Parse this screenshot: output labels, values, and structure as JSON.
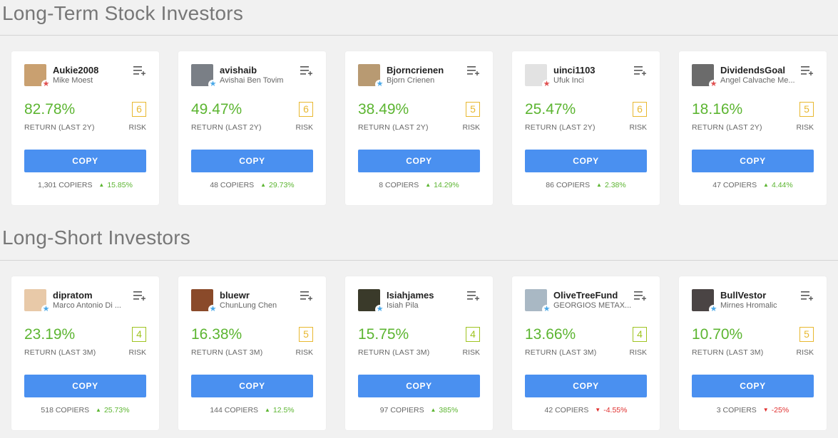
{
  "sections": [
    {
      "title": "Long-Term Stock Investors",
      "investors": [
        {
          "username": "Aukie2008",
          "fullname": "Mike Moest",
          "return": "82.78%",
          "return_label": "RETURN (LAST 2Y)",
          "risk": "6",
          "risk_label": "RISK",
          "copy_label": "COPY",
          "copiers": "1,301 COPIERS",
          "change": "15.85%",
          "direction": "up",
          "badge": "star-red",
          "avatar_color": "#c9a070"
        },
        {
          "username": "avishaib",
          "fullname": "Avishai Ben Tovim",
          "return": "49.47%",
          "return_label": "RETURN (LAST 2Y)",
          "risk": "6",
          "risk_label": "RISK",
          "copy_label": "COPY",
          "copiers": "48 COPIERS",
          "change": "29.73%",
          "direction": "up",
          "badge": "star-blue",
          "avatar_color": "#7a7f86"
        },
        {
          "username": "Bjorncrienen",
          "fullname": "Bjorn Crienen",
          "return": "38.49%",
          "return_label": "RETURN (LAST 2Y)",
          "risk": "5",
          "risk_label": "RISK",
          "copy_label": "COPY",
          "copiers": "8 COPIERS",
          "change": "14.29%",
          "direction": "up",
          "badge": "star-blue",
          "avatar_color": "#b89a72"
        },
        {
          "username": "uinci1103",
          "fullname": "Ufuk Inci",
          "return": "25.47%",
          "return_label": "RETURN (LAST 2Y)",
          "risk": "6",
          "risk_label": "RISK",
          "copy_label": "COPY",
          "copiers": "86 COPIERS",
          "change": "2.38%",
          "direction": "up",
          "badge": "star-red",
          "avatar_color": "#e2e2e2"
        },
        {
          "username": "DividendsGoal",
          "fullname": "Angel Calvache Me...",
          "return": "18.16%",
          "return_label": "RETURN (LAST 2Y)",
          "risk": "5",
          "risk_label": "RISK",
          "copy_label": "COPY",
          "copiers": "47 COPIERS",
          "change": "4.44%",
          "direction": "up",
          "badge": "star-red",
          "avatar_color": "#6b6b6b"
        }
      ]
    },
    {
      "title": "Long-Short Investors",
      "investors": [
        {
          "username": "dipratom",
          "fullname": "Marco Antonio Di ...",
          "return": "23.19%",
          "return_label": "RETURN (LAST 3M)",
          "risk": "4",
          "risk_label": "RISK",
          "copy_label": "COPY",
          "copiers": "518 COPIERS",
          "change": "25.73%",
          "direction": "up",
          "badge": "star-blue",
          "avatar_color": "#e8c9a8"
        },
        {
          "username": "bluewr",
          "fullname": "ChunLung Chen",
          "return": "16.38%",
          "return_label": "RETURN (LAST 3M)",
          "risk": "5",
          "risk_label": "RISK",
          "copy_label": "COPY",
          "copiers": "144 COPIERS",
          "change": "12.5%",
          "direction": "up",
          "badge": "star-blue",
          "avatar_color": "#8a4a2a"
        },
        {
          "username": "Isiahjames",
          "fullname": "Isiah Pila",
          "return": "15.75%",
          "return_label": "RETURN (LAST 3M)",
          "risk": "4",
          "risk_label": "RISK",
          "copy_label": "COPY",
          "copiers": "97 COPIERS",
          "change": "385%",
          "direction": "up",
          "badge": "star-blue",
          "avatar_color": "#3a3a2a"
        },
        {
          "username": "OliveTreeFund",
          "fullname": "GEORGIOS METAX...",
          "return": "13.66%",
          "return_label": "RETURN (LAST 3M)",
          "risk": "4",
          "risk_label": "RISK",
          "copy_label": "COPY",
          "copiers": "42 COPIERS",
          "change": "-4.55%",
          "direction": "down",
          "badge": "star-blue",
          "avatar_color": "#a9b8c4"
        },
        {
          "username": "BullVestor",
          "fullname": "Mirnes Hromalic",
          "return": "10.70%",
          "return_label": "RETURN (LAST 3M)",
          "risk": "5",
          "risk_label": "RISK",
          "copy_label": "COPY",
          "copiers": "3 COPIERS",
          "change": "-25%",
          "direction": "down",
          "badge": "star-blue",
          "avatar_color": "#4a4444"
        }
      ]
    }
  ],
  "colors": {
    "positive": "#5cb531",
    "negative": "#e0302f",
    "copy_button": "#4a90f0",
    "risk_4": "#9fc420",
    "risk_5": "#e8b830",
    "risk_6": "#e8b830",
    "badge_red": "#e05050",
    "badge_blue": "#4aa8e8"
  },
  "icons": {
    "watchlist_add": "list-plus-icon",
    "up": "triangle-up-icon",
    "down": "triangle-down-icon",
    "star": "star-icon"
  }
}
